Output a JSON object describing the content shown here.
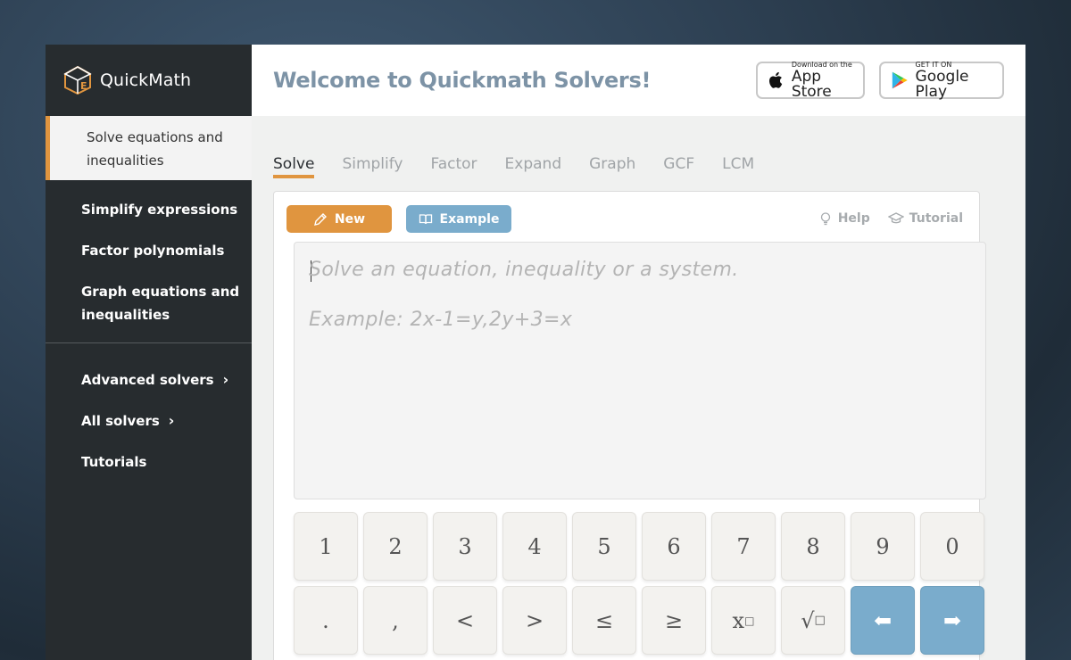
{
  "brand": {
    "name": "QuickMath"
  },
  "sidebar": {
    "active_item": [
      "Solve equations and",
      "inequalities"
    ],
    "items": [
      {
        "label": "Simplify expressions"
      },
      {
        "label": "Factor polynomials"
      },
      {
        "label": [
          "Graph equations and",
          "inequalities"
        ]
      }
    ],
    "secondary": [
      {
        "label": "Advanced solvers",
        "chevron": "›"
      },
      {
        "label": "All solvers",
        "chevron": "›"
      },
      {
        "label": "Tutorials"
      }
    ]
  },
  "header": {
    "title": "Welcome to Quickmath Solvers!",
    "app_store": {
      "small": "Download on the",
      "big": "App Store",
      "icon": "apple-icon"
    },
    "google_play": {
      "small": "GET IT ON",
      "big": "Google Play",
      "icon": "google-play-icon"
    }
  },
  "tabs": [
    {
      "label": "Solve",
      "active": true
    },
    {
      "label": "Simplify",
      "active": false
    },
    {
      "label": "Factor",
      "active": false
    },
    {
      "label": "Expand",
      "active": false
    },
    {
      "label": "Graph",
      "active": false
    },
    {
      "label": "GCF",
      "active": false
    },
    {
      "label": "LCM",
      "active": false
    }
  ],
  "toolbar": {
    "new_label": "New",
    "example_label": "Example",
    "help_label": "Help",
    "tutorial_label": "Tutorial"
  },
  "editor": {
    "placeholder_line1": "Solve an equation, inequality or a system.",
    "placeholder_line2": "Example: 2x-1=y,2y+3=x"
  },
  "keypad": {
    "row1": [
      "1",
      "2",
      "3",
      "4",
      "5",
      "6",
      "7",
      "8",
      "9",
      "0"
    ],
    "row2": [
      ".",
      ",",
      "<",
      ">",
      "≤",
      "≥",
      "x",
      "√",
      "⬅",
      "➡"
    ],
    "power_sup": "□",
    "sqrt_box": "□"
  },
  "colors": {
    "accent_orange": "#e0953f",
    "accent_blue": "#7aaccc",
    "sidebar_bg": "#272c2f",
    "title_color": "#7d93a6"
  }
}
